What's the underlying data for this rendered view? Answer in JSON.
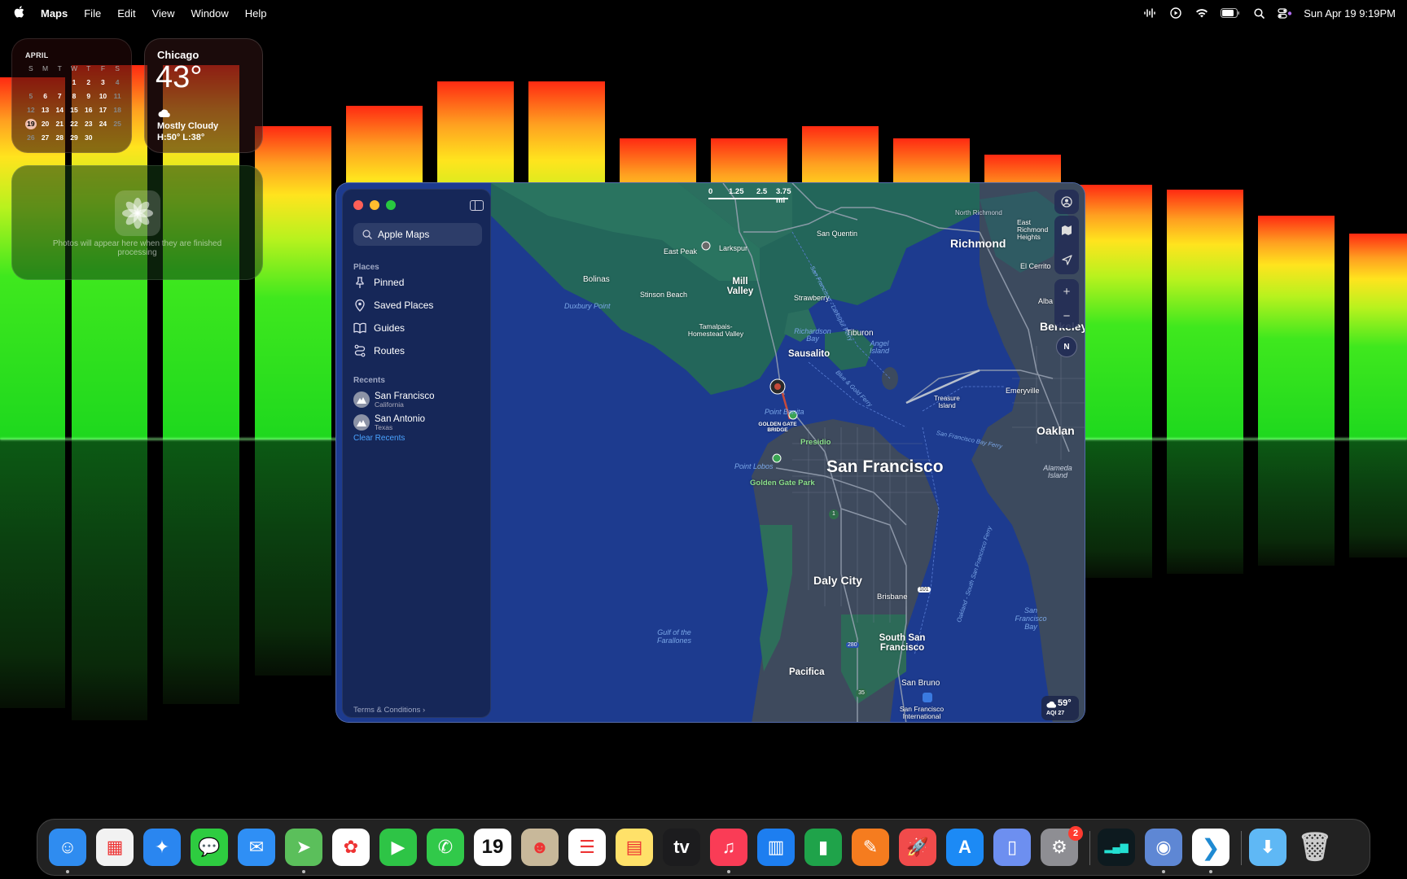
{
  "menubar": {
    "app_name": "Maps",
    "menus": [
      "File",
      "Edit",
      "View",
      "Window",
      "Help"
    ],
    "datetime": "Sun Apr 19  9:19PM"
  },
  "calendar_widget": {
    "month": "APRIL",
    "weekday_headers": [
      "S",
      "M",
      "T",
      "W",
      "T",
      "F",
      "S"
    ],
    "weeks": [
      [
        "",
        "",
        "",
        "1",
        "2",
        "3",
        "4"
      ],
      [
        "5",
        "6",
        "7",
        "8",
        "9",
        "10",
        "11"
      ],
      [
        "12",
        "13",
        "14",
        "15",
        "16",
        "17",
        "18"
      ],
      [
        "19",
        "20",
        "21",
        "22",
        "23",
        "24",
        "25"
      ],
      [
        "26",
        "27",
        "28",
        "29",
        "30",
        "",
        ""
      ]
    ],
    "today": "19"
  },
  "weather_widget": {
    "city": "Chicago",
    "temperature": "43°",
    "condition": "Mostly Cloudy",
    "high_low": "H:50° L:38°"
  },
  "photos_widget": {
    "message": "Photos will appear here when they are finished processing"
  },
  "maps": {
    "search_placeholder": "Apple Maps",
    "places_title": "Places",
    "places": [
      {
        "label": "Pinned",
        "icon": "pin-icon"
      },
      {
        "label": "Saved Places",
        "icon": "saved-places-icon"
      },
      {
        "label": "Guides",
        "icon": "book-icon"
      },
      {
        "label": "Routes",
        "icon": "routes-icon"
      }
    ],
    "recents_title": "Recents",
    "recents": [
      {
        "name": "San Francisco",
        "sub": "California"
      },
      {
        "name": "San Antonio",
        "sub": "Texas"
      }
    ],
    "clear_recents": "Clear Recents",
    "terms": "Terms & Conditions",
    "scale_labels": [
      "0",
      "1.25",
      "2.5",
      "3.75 mi"
    ],
    "compass_label": "N",
    "weather_chip": {
      "temp": "59°",
      "aqi": "AQI 27"
    },
    "labels": {
      "north_richmond": "North Richmond",
      "east_richmond_heights": "East Richmond Heights",
      "richmond": "Richmond",
      "el_cerrito": "El Cerrito",
      "albany": "Alba",
      "berkeley": "Berkeley",
      "san_quentin": "San Quentin",
      "larkspur": "Larkspur",
      "east_peak": "East Peak",
      "bolinas": "Bolinas",
      "stinson_beach": "Stinson Beach",
      "mill_valley": "Mill Valley",
      "strawberry": "Strawberry",
      "duxbury_point": "Duxbury Point",
      "tamalpais": "Tamalpais-Homestead Valley",
      "richardson_bay": "Richardson Bay",
      "tiburon": "Tiburon",
      "angel_island": "Angel Island",
      "sausalito": "Sausalito",
      "emeryville": "Emeryville",
      "treasure_island": "Treasure Island",
      "oakland": "Oaklan",
      "point_bonita": "Point Bonita",
      "golden_gate_bridge": "GOLDEN GATE BRIDGE",
      "presidio": "Presidio",
      "point_lobos": "Point Lobos",
      "san_francisco": "San Francisco",
      "golden_gate_park": "Golden Gate Park",
      "alameda": "Alameda Island",
      "daly_city": "Daly City",
      "brisbane": "Brisbane",
      "south_san_francisco": "South San Francisco",
      "pacifica": "Pacifica",
      "san_bruno": "San Bruno",
      "sfo": "San Francisco International",
      "gulf_farallones": "Gulf of the Farallones",
      "sf_bay": "San Francisco Bay",
      "larkspur_ferry": "San Francisco - Larkspur Ferry",
      "blue_gold_ferry": "Blue & Gold Ferry",
      "sf_bay_ferry": "San Francisco Bay Ferry",
      "oakland_ssf_ferry": "Oakland - South San Francisco Ferry",
      "route_1": "1",
      "route_101": "101",
      "route_280": "280",
      "route_35": "35"
    }
  },
  "dock": {
    "apps": [
      {
        "name": "Finder",
        "icon": "finder-icon",
        "glyph": "☺",
        "bg": "#2f8cf0",
        "running": true
      },
      {
        "name": "Launchpad",
        "icon": "launchpad-icon",
        "glyph": "▦",
        "bg": "#f2f2f2",
        "running": false
      },
      {
        "name": "Safari",
        "icon": "safari-icon",
        "glyph": "✦",
        "bg": "#2a86f0",
        "running": false
      },
      {
        "name": "Messages",
        "icon": "messages-icon",
        "glyph": "💬",
        "bg": "#2ecc40",
        "running": false
      },
      {
        "name": "Mail",
        "icon": "mail-icon",
        "glyph": "✉",
        "bg": "#2f8ff5",
        "running": false
      },
      {
        "name": "Maps",
        "icon": "maps-icon",
        "glyph": "➤",
        "bg": "#5bbf5b",
        "running": true
      },
      {
        "name": "Photos",
        "icon": "photos-icon",
        "glyph": "✿",
        "bg": "#ffffff",
        "running": false
      },
      {
        "name": "FaceTime",
        "icon": "facetime-icon",
        "glyph": "▶",
        "bg": "#2ec446",
        "running": false
      },
      {
        "name": "Phone",
        "icon": "phone-icon",
        "glyph": "✆",
        "bg": "#31c94a",
        "running": false
      },
      {
        "name": "Calendar",
        "icon": "calendar-icon",
        "glyph": "19",
        "bg": "#ffffff",
        "running": false
      },
      {
        "name": "Contacts",
        "icon": "contacts-icon",
        "glyph": "☻",
        "bg": "#c8b89a",
        "running": false
      },
      {
        "name": "Reminders",
        "icon": "reminders-icon",
        "glyph": "☰",
        "bg": "#ffffff",
        "running": false
      },
      {
        "name": "Notes",
        "icon": "notes-icon",
        "glyph": "▤",
        "bg": "#ffe169",
        "running": false
      },
      {
        "name": "TV",
        "icon": "tv-icon",
        "glyph": "tv",
        "bg": "#1c1c1e",
        "running": false
      },
      {
        "name": "Music",
        "icon": "music-icon",
        "glyph": "♫",
        "bg": "#fa3c56",
        "running": true
      },
      {
        "name": "Keynote",
        "icon": "keynote-icon",
        "glyph": "▥",
        "bg": "#1d7ef0",
        "running": false
      },
      {
        "name": "Numbers",
        "icon": "numbers-icon",
        "glyph": "▮",
        "bg": "#1fa34a",
        "running": false
      },
      {
        "name": "Pages",
        "icon": "pages-icon",
        "glyph": "✎",
        "bg": "#f57c1f",
        "running": false
      },
      {
        "name": "Rocket",
        "icon": "rocket-icon",
        "glyph": "🚀",
        "bg": "#f14b4b",
        "running": false
      },
      {
        "name": "App Store",
        "icon": "app-store-icon",
        "glyph": "A",
        "bg": "#1c8af5",
        "running": false
      },
      {
        "name": "iPhone Mirroring",
        "icon": "iphone-mirroring-icon",
        "glyph": "▯",
        "bg": "#6d8ff0",
        "running": false
      },
      {
        "name": "System Settings",
        "icon": "settings-icon",
        "glyph": "⚙",
        "bg": "#8e8e93",
        "running": false,
        "badge": "2"
      },
      {
        "name": "Audio Visualizer",
        "icon": "visualizer-icon",
        "glyph": "▂▄▆",
        "bg": "#0d1a1f",
        "running": false
      },
      {
        "name": "Disk Utility",
        "icon": "disk-icon",
        "glyph": "◉",
        "bg": "#5e87d4",
        "running": true
      },
      {
        "name": "VS Code",
        "icon": "vscode-icon",
        "glyph": "❯",
        "bg": "#ffffff",
        "running": true
      },
      {
        "name": "Downloads",
        "icon": "downloads-folder-icon",
        "glyph": "⬇",
        "bg": "#5fb8f5",
        "running": false
      },
      {
        "name": "Trash",
        "icon": "trash-icon",
        "glyph": "🗑",
        "bg": "transparent",
        "running": false
      }
    ]
  }
}
